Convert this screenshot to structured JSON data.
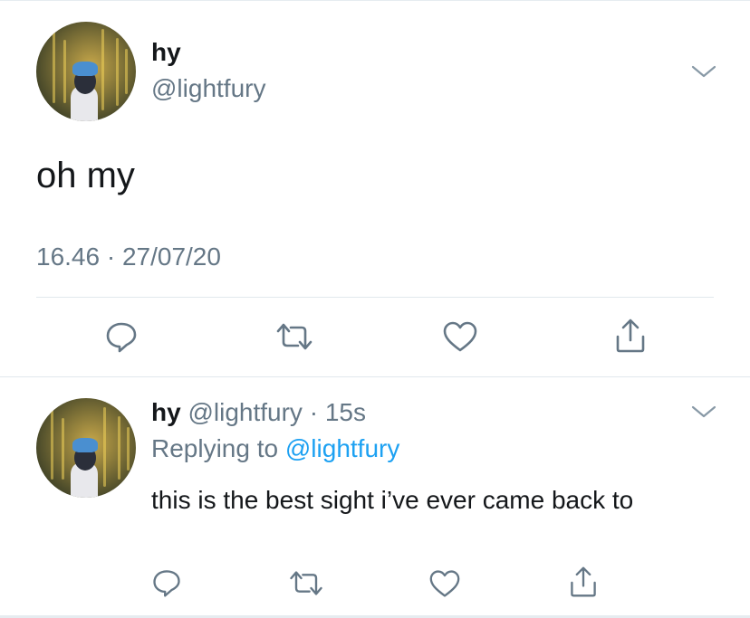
{
  "main_tweet": {
    "display_name": "hy",
    "handle": "@lightfury",
    "text": "oh my",
    "timestamp": "16.46 · 27/07/20"
  },
  "reply_tweet": {
    "display_name": "hy",
    "handle": "@lightfury",
    "time_ago": "· 15s",
    "replying_prefix": "Replying to",
    "replying_mention": "@lightfury",
    "text": "this is the best sight i’ve ever came back to"
  },
  "actions": [
    "reply-icon",
    "retweet-icon",
    "like-icon",
    "share-icon"
  ],
  "colors": {
    "text": "#14171a",
    "secondary": "#657786",
    "link": "#1da1f2",
    "divider": "#e1e8ed"
  }
}
